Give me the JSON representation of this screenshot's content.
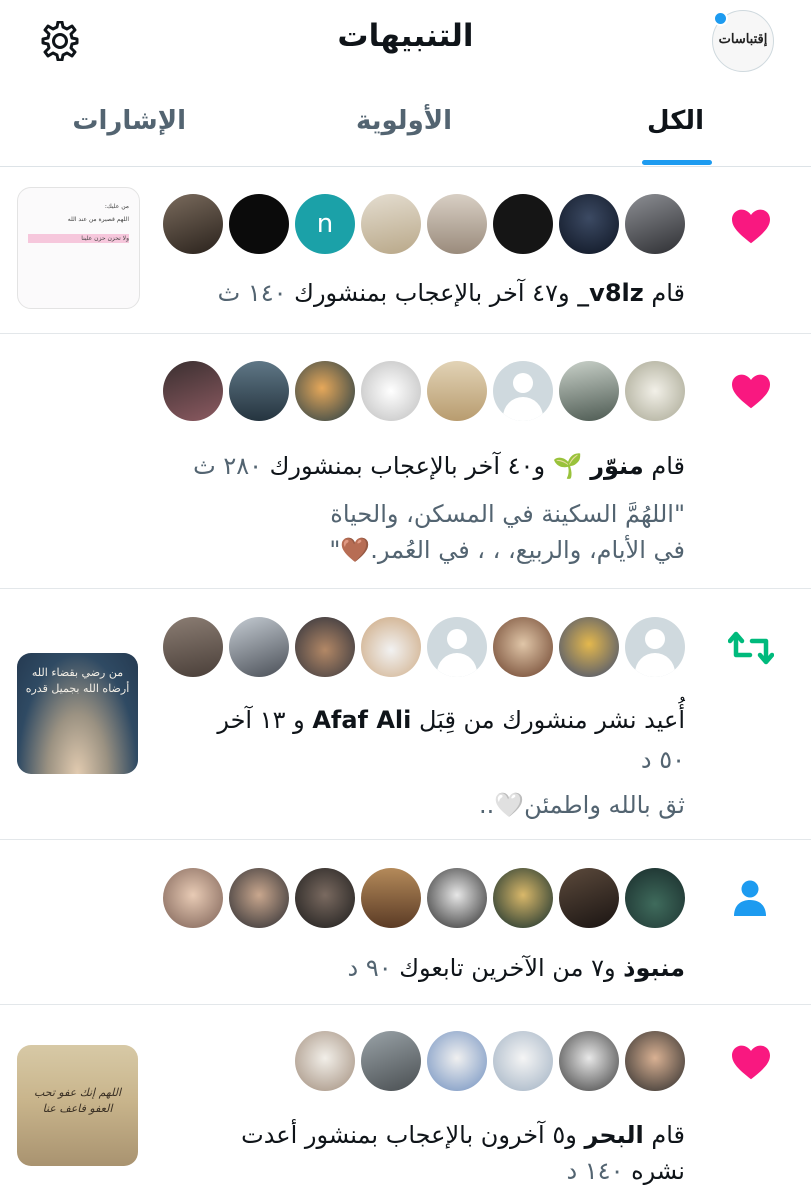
{
  "header": {
    "title": "التنبيهات",
    "account_label": "إقتباسات"
  },
  "tabs": [
    {
      "label": "الكل"
    },
    {
      "label": "الأولوية"
    },
    {
      "label": "الإشارات"
    }
  ],
  "colors": {
    "accent": "#1d9bf0",
    "like": "#f91880",
    "retweet": "#00ba7c",
    "follow": "#1d9bf0"
  },
  "notifications": [
    {
      "type": "like",
      "icon": "heart-icon",
      "pre": "قام ",
      "name": "v8lz_",
      "rest": " و٤٧ آخر بالإعجاب بمنشورك ",
      "time": "١٤٠ ث",
      "thumb_text": [
        "من عليك:",
        "اللهم قصيرة من عند الله",
        "ولا تحزن حزن علينا"
      ]
    },
    {
      "type": "like",
      "icon": "heart-icon",
      "pre": "قام ",
      "name": "منوّر",
      "emoji": "🌱",
      "rest": " و٤٠ آخر بالإعجاب بمنشورك ",
      "time": "٢٨٠ ث",
      "quote_lines": [
        "\"اللهُمَّ السكينة في المسكن، والحياة",
        "في الأيام، والربيع، ، ، في العُمر.🤎\""
      ]
    },
    {
      "type": "retweet",
      "icon": "retweet-icon",
      "pre": "أُعيد نشر منشورك من قِبَل ",
      "name": "Afaf Ali",
      "rest": " و ١٣ آخر",
      "time": "٥٠ د",
      "quote_lines": [
        "ثق بالله واطمئن🤍.."
      ],
      "thumb_text": [
        "من رضي بقضاء الله",
        "أرضاه الله بجميل قدره"
      ]
    },
    {
      "type": "follow",
      "icon": "person-icon",
      "pre": "",
      "name": "منبوذ",
      "rest": " و٧ من الآخرين تابعوك ",
      "time": "٩٠ د"
    },
    {
      "type": "like",
      "icon": "heart-icon",
      "pre": "قام ",
      "name": "البحر",
      "rest": " و٥ آخرون بالإعجاب بمنشور أعدت",
      "line2": "نشره ",
      "time": "١٤٠ د",
      "thumb_text": [
        "اللهم إنك عفو تحب",
        "العفو فاعف عنا"
      ]
    }
  ]
}
